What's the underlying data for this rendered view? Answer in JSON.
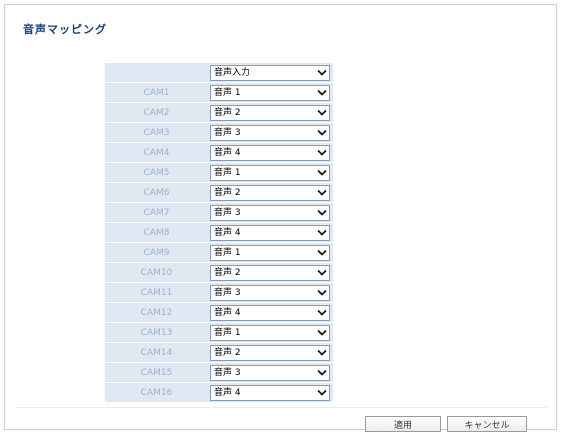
{
  "page": {
    "title": "音声マッピング"
  },
  "mapping": {
    "header_value": "音声入力",
    "rows": [
      {
        "camera": "CAM1",
        "audio": "音声 1"
      },
      {
        "camera": "CAM2",
        "audio": "音声 2"
      },
      {
        "camera": "CAM3",
        "audio": "音声 3"
      },
      {
        "camera": "CAM4",
        "audio": "音声 4"
      },
      {
        "camera": "CAM5",
        "audio": "音声 1"
      },
      {
        "camera": "CAM6",
        "audio": "音声 2"
      },
      {
        "camera": "CAM7",
        "audio": "音声 3"
      },
      {
        "camera": "CAM8",
        "audio": "音声 4"
      },
      {
        "camera": "CAM9",
        "audio": "音声 1"
      },
      {
        "camera": "CAM10",
        "audio": "音声 2"
      },
      {
        "camera": "CAM11",
        "audio": "音声 3"
      },
      {
        "camera": "CAM12",
        "audio": "音声 4"
      },
      {
        "camera": "CAM13",
        "audio": "音声 1"
      },
      {
        "camera": "CAM14",
        "audio": "音声 2"
      },
      {
        "camera": "CAM15",
        "audio": "音声 3"
      },
      {
        "camera": "CAM16",
        "audio": "音声 4"
      }
    ]
  },
  "buttons": {
    "apply_label": "適用",
    "cancel_label": "キャンセル"
  },
  "colors": {
    "title": "#1a3d7c",
    "cell_background": "#dfe8f3",
    "camera_label": "#9fb2c9",
    "select_border": "#7f9db9"
  },
  "icons": {
    "dropdown": "chevron-down-icon"
  }
}
